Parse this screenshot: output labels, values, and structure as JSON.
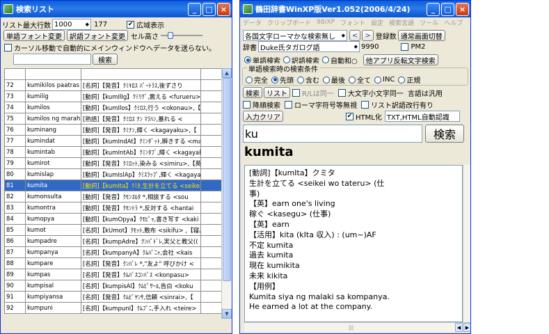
{
  "list_window": {
    "title": "検索リスト",
    "max_rows_label": "リスト最大行数",
    "max_rows_value": "1000",
    "count": "177",
    "wide_display_label": "広域表示",
    "word_font_btn": "単語フォント変更",
    "trans_font_btn": "訳語フォント変更",
    "cell_height_label": "セル高さ",
    "cursor_move_label": "カーソル移動で自動的にメインウィンドウへデータを送らない。",
    "search_btn": "検索",
    "rows": [
      {
        "n": "72",
        "w": "kumikilos paatras",
        "d": "[名詞]【発音】ｸﾐｷﾛｽ ﾊﾟｰﾄﾗｽ,後ずさり"
      },
      {
        "n": "73",
        "w": "kumilig",
        "d": "[動詞]【kumIlIg】ｸﾐﾘｸﾞ,震える <furueru>,【"
      },
      {
        "n": "74",
        "w": "kumilos",
        "d": "[動詞]【kumIlos】ｸﾐﾛｽ,行う <okonau>,【"
      },
      {
        "n": "75",
        "w": "kumilos ng marah",
        "d": "[熟語]【発音】ｸﾐﾛｽ ﾅﾝ ﾏﾗﾊﾝ,暴れる <"
      },
      {
        "n": "76",
        "w": "kuminang",
        "d": "[動詞]【発音】ｸﾐﾅﾝ,輝く <kagayaku>,【"
      },
      {
        "n": "77",
        "w": "kumindat",
        "d": "[動詞]【kumIndAt】ｸﾐﾝﾀﾞｯﾄ,瞬きする <mal"
      },
      {
        "n": "78",
        "w": "kumintab",
        "d": "[動詞]【kumIntAb】ｸﾐﾝﾀﾌﾞ,輝く <kagayal"
      },
      {
        "n": "79",
        "w": "kumirot",
        "d": "[動詞]【発音】ｸﾐﾛｯﾄ,染みる <simiru>,【英"
      },
      {
        "n": "80",
        "w": "kumislap",
        "d": "[動詞]【kumIslAp】ｸﾐｽﾗｯﾌﾟ,輝く <kagaya"
      },
      {
        "n": "81",
        "w": "kumita",
        "d": "[動詞]【kumIta】ｸﾐﾀ,生計を立てる <seike"
      },
      {
        "n": "82",
        "w": "kumonsulta",
        "d": "[動詞]【発音】ｸﾓﾝｽﾙﾀ *,相談する <sou"
      },
      {
        "n": "83",
        "w": "kumontra",
        "d": "[動詞]【発音】ｸﾓﾝﾄﾗ *,反対する <hantai"
      },
      {
        "n": "84",
        "w": "kumopya",
        "d": "[動詞]【kumOpya】ｸﾓﾋﾟｬ,書き写す <kaki"
      },
      {
        "n": "85",
        "w": "kumot",
        "d": "[名詞]【kUmot】ｸﾓｯﾄ,敷布 <sikifu> ,【寝具"
      },
      {
        "n": "86",
        "w": "kumpadre",
        "d": "[名詞]【kumpAdre】ｸﾝﾊﾟﾄﾞﾚ,実父と教父(("
      },
      {
        "n": "87",
        "w": "kumpanya",
        "d": "[名詞]【kumpanyA】ｸﾑﾊﾟﾆｬ,会社 <kais"
      },
      {
        "n": "88",
        "w": "kumpare",
        "d": "[名詞]【発音】ｸﾝﾊﾟﾚ *,\"友よ\" 呼びかけ <"
      },
      {
        "n": "89",
        "w": "kumpas",
        "d": "[名詞]【発音】ｸﾑﾊﾟｽｺﾝﾊﾟｽ <konpasu>"
      },
      {
        "n": "90",
        "w": "kumpisal",
        "d": "[名詞]【kumpisAl】ｸﾑﾋﾟｻｰﾙ,告白 <koku"
      },
      {
        "n": "91",
        "w": "kumpiyansa",
        "d": "[名詞]【発音】ｸﾑﾋﾟﾔﾝｻ,信頼 <sinrai>,【"
      },
      {
        "n": "92",
        "w": "kumpuni",
        "d": "[名詞]【kumpunI】ｸﾑﾌﾟﾆ,手入れ <teire>"
      }
    ],
    "selected_row_index": 9
  },
  "main_window": {
    "title": "鶴田辞書WinXP版Ver1.052(2006/4/24)",
    "menu": [
      "データ",
      "クリップボード",
      "98/XP",
      "フォント",
      "設定",
      "検索言語",
      "ツール",
      "ヘルプ"
    ],
    "mode_select": "各国文字ローマかな検索無し",
    "register_count_label": "登録数",
    "normal_screen_btn": "通常画面切替",
    "dict_label": "辞書",
    "dict_value": "Duke氏タガログ語",
    "dict_count": "9990",
    "pm2_label": "PM2",
    "search_modes": [
      "単語検索",
      "訳語検索",
      "自動和○"
    ],
    "other_app_btn": "他アプリ反転文字検索",
    "group_label": "単語検索時の検索条件",
    "match_modes": [
      "完全",
      "先頭",
      "含む",
      "最後",
      "全て",
      "INC",
      "正規"
    ],
    "search_btn": "検索",
    "list_btn": "リスト",
    "r_l_same": "R/Lは同一",
    "case_same": "大文字小文字同一",
    "lang_general": "言語は汎用",
    "reverse_search": "降順検索",
    "roman_ignore": "ローマ字符号等無視",
    "list_trans_newline": "リスト訳語改行有り",
    "input_clear_btn": "入力クリア",
    "html_label": "HTML化",
    "html_select": "TXT,HTML自動認識",
    "query": "ku",
    "search_big_btn": "検索",
    "headword": "kumita",
    "definition": [
      "[動詞]【kumIta】クミタ",
      "生計を立てる <seikei wo tateru> (仕",
      "事)",
      "【英】earn one's living",
      "稼ぐ <kasegu> (仕事)",
      "【英】earn",
      "【活用】kita (kIta 収入) : (um~)AF",
      "不定 kumita",
      "過去 kumita",
      "現在 kumikita",
      "未来 kikita",
      "【用例】",
      "Kumita siya ng malaki sa kompanya.",
      "He earned a lot at the company."
    ]
  }
}
